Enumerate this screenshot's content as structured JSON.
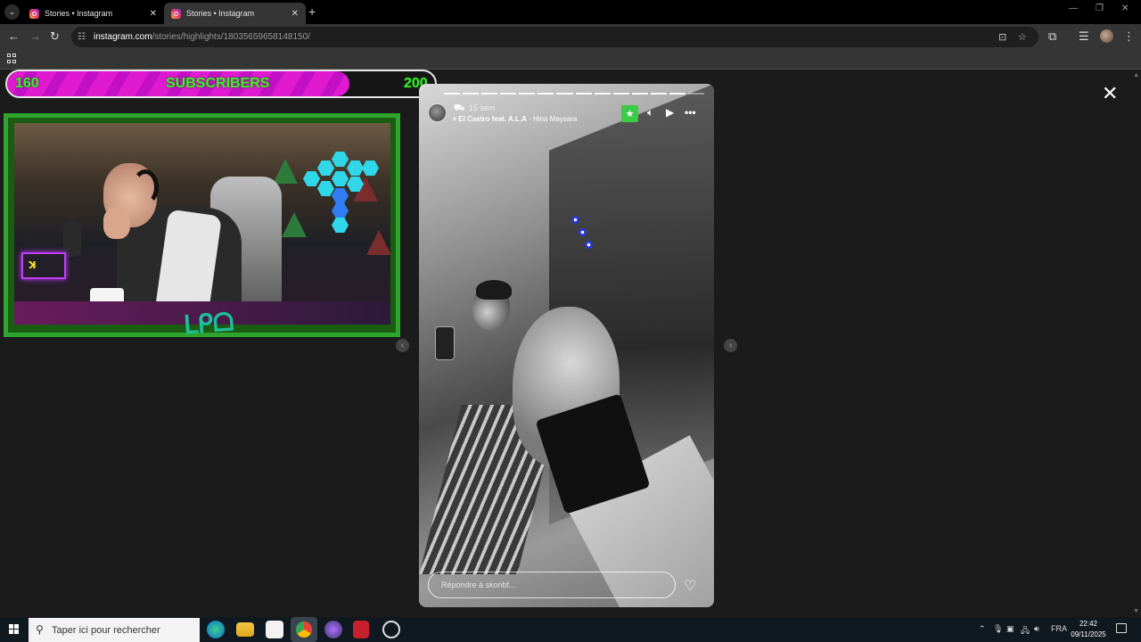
{
  "browser": {
    "tabs": [
      {
        "label": "Stories • Instagram",
        "active": false
      },
      {
        "label": "Stories • Instagram",
        "active": true
      }
    ],
    "url_host": "instagram.com",
    "url_path": "/stories/highlights/18035659658148150/"
  },
  "overlay": {
    "sub_current": "160",
    "sub_label": "SUBSCRIBERS",
    "sub_goal": "200",
    "sub_progress": 0.8,
    "fill_color": "#e01ad0",
    "text_color": "#3cf02b"
  },
  "story": {
    "time_ago": "15 sem",
    "song_title": "El Castro feat. A.L.A",
    "song_artist": "Hina Maysara",
    "song_separator": "·",
    "reply_placeholder": "Répondre à skonbf...",
    "segments_total": 14,
    "segments_viewed": 13
  },
  "taskbar": {
    "search_placeholder": "Taper ici pour rechercher",
    "lang": "FRA",
    "time": "22:42",
    "date": "09/11/2025"
  }
}
